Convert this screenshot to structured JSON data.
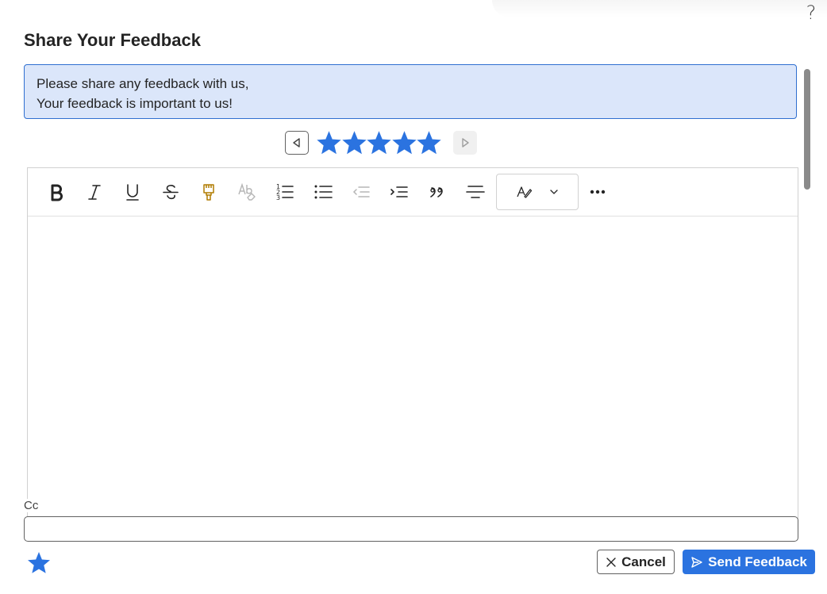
{
  "help": {
    "label": "?"
  },
  "dialog": {
    "title": "Share Your Feedback"
  },
  "info": {
    "line1": "Please share any feedback with us,",
    "line2": "Your feedback is important to us!"
  },
  "rating": {
    "value": 5,
    "max": 5,
    "color": "#2b73e0"
  },
  "toolbar": {
    "buttons": [
      {
        "name": "bold-icon"
      },
      {
        "name": "italic-icon"
      },
      {
        "name": "underline-icon"
      },
      {
        "name": "strikethrough-icon"
      },
      {
        "name": "format-painter-icon"
      },
      {
        "name": "clear-formatting-icon"
      },
      {
        "name": "numbered-list-icon"
      },
      {
        "name": "bulleted-list-icon"
      },
      {
        "name": "decrease-indent-icon"
      },
      {
        "name": "increase-indent-icon"
      },
      {
        "name": "quote-icon"
      },
      {
        "name": "align-center-icon"
      },
      {
        "name": "styles-dropdown-icon"
      },
      {
        "name": "more-options-icon"
      }
    ]
  },
  "cc": {
    "label": "Cc",
    "value": "",
    "placeholder": ""
  },
  "actions": {
    "cancel_label": "Cancel",
    "send_label": "Send Feedback"
  },
  "colors": {
    "accent": "#2b73e0",
    "info_bg": "#dbe6fa",
    "info_border": "#2f6fd0",
    "format_painter": "#b07c00"
  }
}
